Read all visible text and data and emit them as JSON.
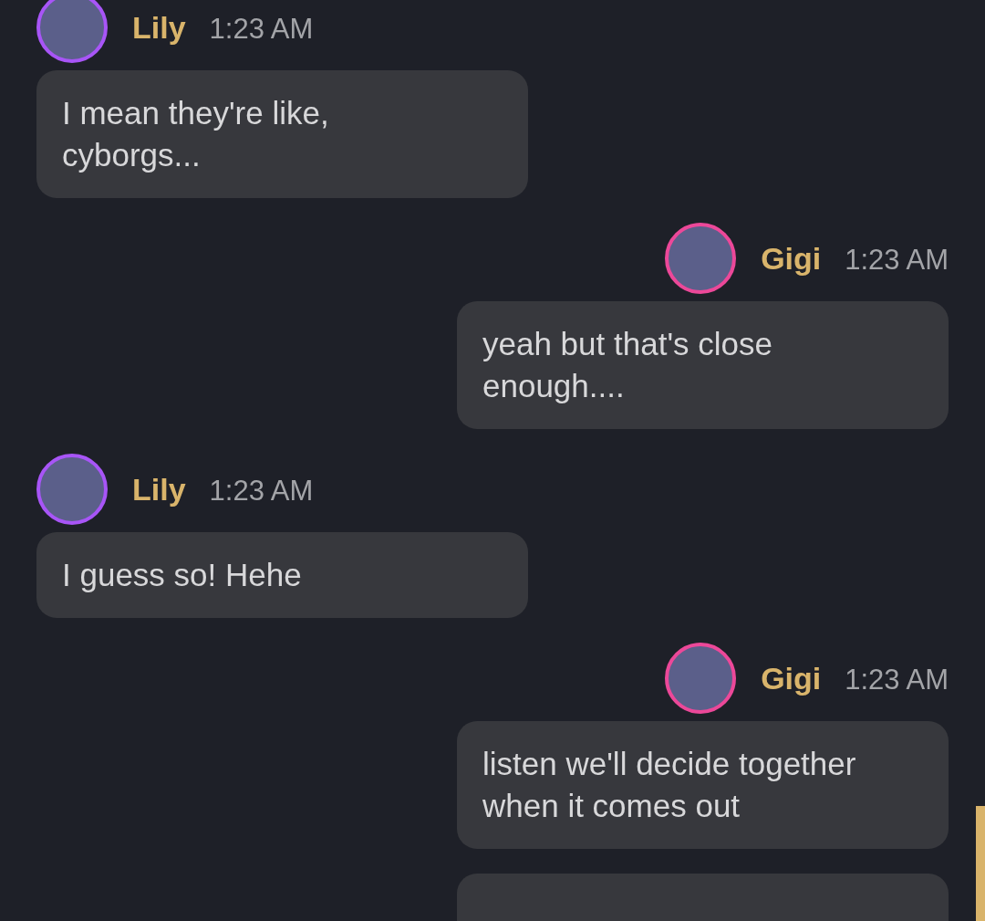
{
  "messages": [
    {
      "author": "Lily",
      "time": "1:23 AM",
      "kind": "incoming",
      "color": "#a855f7",
      "text": "I mean they're like, cyborgs..."
    },
    {
      "author": "Gigi",
      "time": "1:23 AM",
      "kind": "outgoing",
      "color": "#ec4899",
      "text": "yeah but that's close enough...."
    },
    {
      "author": "Lily",
      "time": "1:23 AM",
      "kind": "incoming",
      "color": "#a855f7",
      "text": "I guess so! Hehe"
    },
    {
      "author": "Gigi",
      "time": "1:23 AM",
      "kind": "outgoing",
      "color": "#ec4899",
      "text": "listen we'll decide together when it comes out"
    },
    {
      "kind": "outgoing"
    }
  ]
}
